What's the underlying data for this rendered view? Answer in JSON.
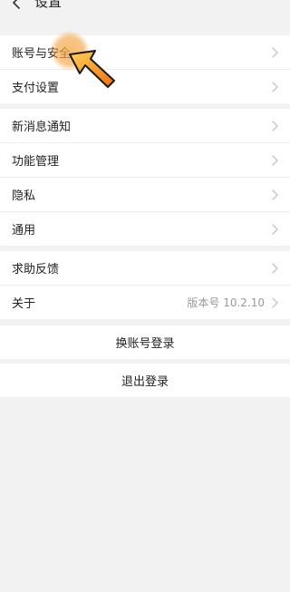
{
  "header": {
    "title": "设置"
  },
  "groups": [
    {
      "items": [
        {
          "label": "账号与安全"
        },
        {
          "label": "支付设置"
        }
      ]
    },
    {
      "items": [
        {
          "label": "新消息通知"
        },
        {
          "label": "功能管理"
        },
        {
          "label": "隐私"
        },
        {
          "label": "通用"
        }
      ]
    },
    {
      "items": [
        {
          "label": "求助反馈"
        },
        {
          "label": "关于",
          "value": "版本号 10.2.10"
        }
      ]
    }
  ],
  "actions": {
    "switch_account": "换账号登录",
    "logout": "退出登录"
  },
  "icons": {
    "back": "chevron-left-icon",
    "row_arrow": "chevron-right-icon",
    "pointer": "hand-pointer-arrow-icon"
  },
  "colors": {
    "background": "#f2f2f2",
    "row": "#ffffff",
    "text": "#222222",
    "muted": "#9a9a9a",
    "pointer_orange": "#f28a0f"
  }
}
